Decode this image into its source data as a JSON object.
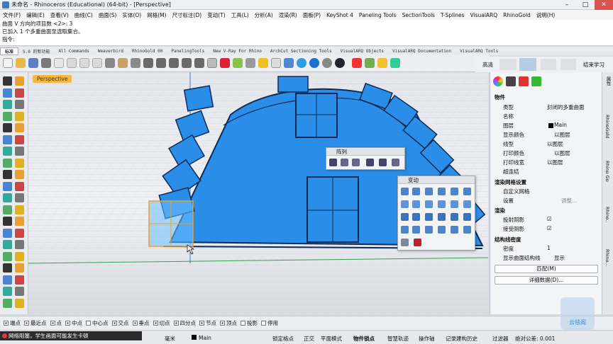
{
  "window": {
    "title": "未命名 - Rhinoceros (Educational) (64-bit) - [Perspective]"
  },
  "menu": [
    "文件(F)",
    "编辑(E)",
    "查看(V)",
    "曲线(C)",
    "曲面(S)",
    "实体(O)",
    "网格(M)",
    "尺寸标注(D)",
    "变动(T)",
    "工具(L)",
    "分析(A)",
    "渲染(R)",
    "面板(P)",
    "KeyShot 4",
    "Paneling Tools",
    "SectionTools",
    "T-Splines",
    "VisualARQ",
    "RhinoGold",
    "说明(H)"
  ],
  "command": {
    "line1": "曲面 V 方向的项目数 <2>: 3",
    "line2": "已加入 1 个多重曲面至选取集合。",
    "prompt": "指令:"
  },
  "tabs": [
    "标准",
    "5.0 的新功能",
    "All Commands",
    "Weaverbird",
    "RhinoGold 00",
    "PanelingTools",
    "New V-Ray For Rhino",
    "ArchCut Sectioning Tools",
    "VisualARQ Objects",
    "VisualARQ Documentation",
    "VisualARQ Tools"
  ],
  "right_tabs": {
    "high": "高清",
    "end": "结束学习"
  },
  "viewport": {
    "label": "Perspective"
  },
  "array_toolbar": {
    "title": "阵列"
  },
  "transform_toolbar": {
    "title": "变动"
  },
  "panel": {
    "object": "物件",
    "type_k": "类型",
    "type_v": "封闭的多重曲面",
    "name_k": "名称",
    "layer_k": "图层",
    "layer_v": "Main",
    "color_k": "显示颜色",
    "color_v": "以图层",
    "linetype_k": "线型",
    "linetype_v": "以图层",
    "print_color_k": "打印颜色",
    "print_color_v": "以图层",
    "print_width_k": "打印线宽",
    "print_width_v": "以图层",
    "hyperlink_k": "超连结",
    "mesh_sec": "渲染网格设置",
    "custom_mesh_k": "自定义网格",
    "settings_k": "设置",
    "adjust": "调整...",
    "render_sec": "渲染",
    "cast_k": "投射阴影",
    "recv_k": "接受阴影",
    "iso_sec": "结构线密度",
    "density_k": "密度",
    "density_v": "1",
    "show_iso_k": "显示曲面结构线",
    "show_iso_v": "显示",
    "match": "匹配(M)",
    "details": "详细数据(D)..."
  },
  "vtabs": [
    "属性",
    "RhinoGold",
    "Rhino Go",
    "Rhino..",
    "Rhino..."
  ],
  "osnaps": [
    {
      "l": "端点",
      "on": true
    },
    {
      "l": "最近点",
      "on": true
    },
    {
      "l": "点",
      "on": true
    },
    {
      "l": "中点",
      "on": true
    },
    {
      "l": "中心点",
      "on": false
    },
    {
      "l": "交点",
      "on": true
    },
    {
      "l": "垂点",
      "on": true
    },
    {
      "l": "切点",
      "on": true
    },
    {
      "l": "四分点",
      "on": true
    },
    {
      "l": "节点",
      "on": true
    },
    {
      "l": "顶点",
      "on": true
    },
    {
      "l": "投影",
      "on": false
    },
    {
      "l": "停用",
      "on": false
    }
  ],
  "status": {
    "warn": "网络阻塞，学生画面可能发生卡顿",
    "unit": "毫米",
    "layer": "Main",
    "grid": "锁定格点",
    "ortho": "正交",
    "planar": "平面模式",
    "osnap": "物件锁点",
    "smart": "智慧轨迹",
    "gumball": "操作轴",
    "history": "记录建构历史",
    "filter": "过滤器",
    "tol": "绝对公差: 0.001"
  },
  "watermark": "云毯阁"
}
